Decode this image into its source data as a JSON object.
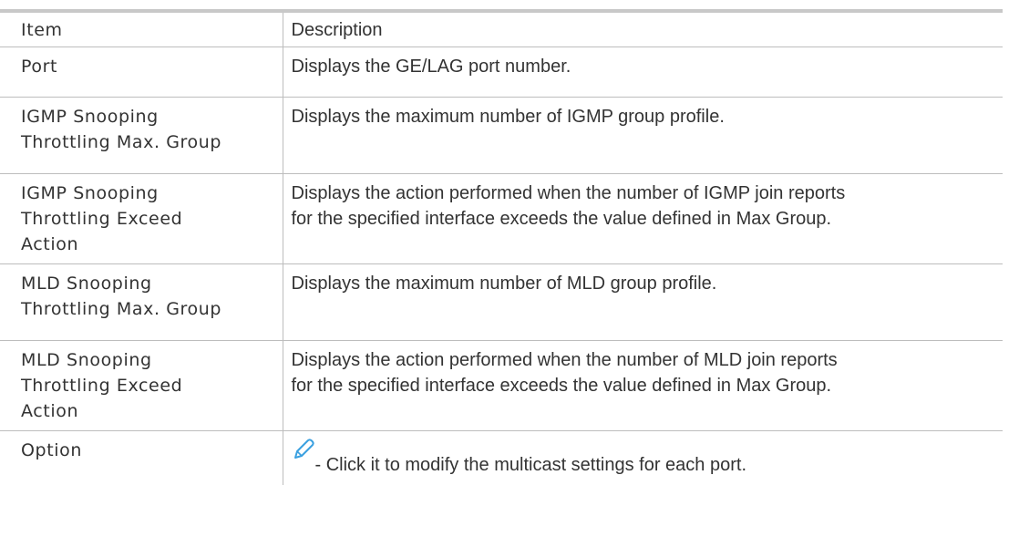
{
  "table": {
    "header": {
      "item": "Item",
      "description": "Description"
    },
    "rows": [
      {
        "item": "Port",
        "description": "Displays the GE/LAG port number."
      },
      {
        "item_lines": [
          "IGMP Snooping",
          "Throttling Max. Group"
        ],
        "description": "Displays the maximum number of IGMP group profile."
      },
      {
        "item_lines": [
          "IGMP Snooping",
          "Throttling Exceed",
          "Action"
        ],
        "description_lines": [
          "Displays the action performed when the number of IGMP join reports",
          "for the specified interface exceeds the value defined in Max Group."
        ]
      },
      {
        "item_lines": [
          "MLD Snooping",
          "Throttling Max. Group"
        ],
        "description": "Displays the maximum number of MLD group profile."
      },
      {
        "item_lines": [
          "MLD Snooping",
          "Throttling Exceed",
          "Action"
        ],
        "description_lines": [
          "Displays the action performed when the number of MLD join reports",
          "for the specified interface exceeds the value defined in Max Group."
        ]
      },
      {
        "item": "Option",
        "icon": "pencil-icon",
        "description": "- Click it to modify the multicast settings for each port."
      }
    ]
  },
  "colors": {
    "text": "#333333",
    "border": "#bdbdbd",
    "top_rule": "#c8c8c8",
    "icon": "#3aa0e0"
  }
}
